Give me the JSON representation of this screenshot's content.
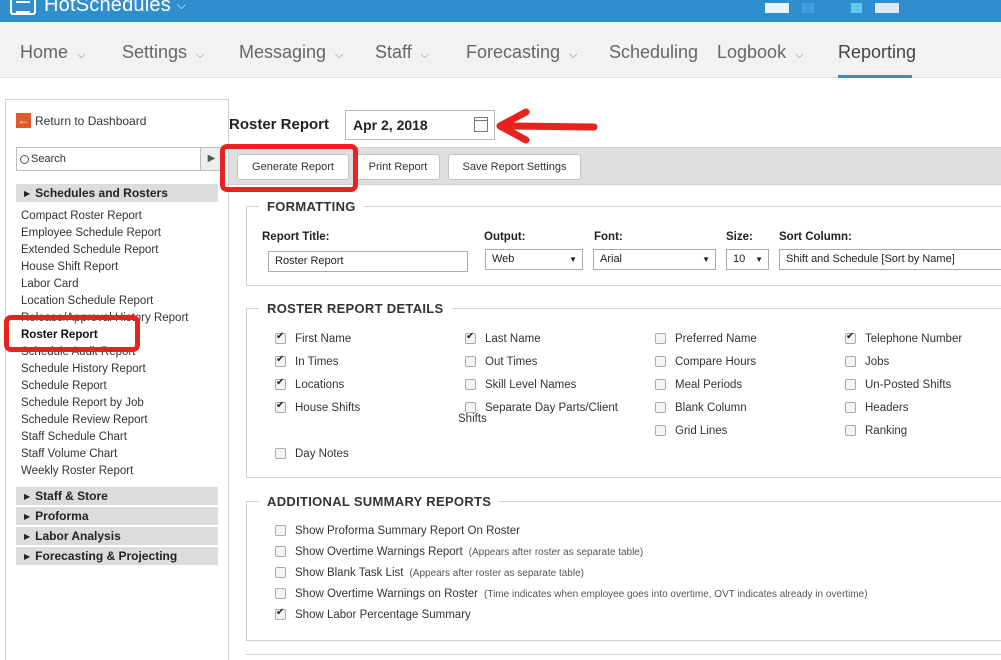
{
  "app": {
    "name": "HotSchedules"
  },
  "nav": [
    {
      "label": "Home",
      "caret": true
    },
    {
      "label": "Settings",
      "caret": true
    },
    {
      "label": "Messaging",
      "caret": true
    },
    {
      "label": "Staff",
      "caret": true
    },
    {
      "label": "Forecasting",
      "caret": true
    },
    {
      "label": "Scheduling",
      "caret": false
    },
    {
      "label": "Logbook",
      "caret": true
    },
    {
      "label": "Reporting",
      "caret": false,
      "active": true
    }
  ],
  "sidebar": {
    "return_label": "Return to Dashboard",
    "search_placeholder": "Search",
    "sections": [
      "Schedules and Rosters",
      "Staff & Store",
      "Proforma",
      "Labor Analysis",
      "Forecasting & Projecting"
    ],
    "links": [
      "Compact Roster Report",
      "Employee Schedule Report",
      "Extended Schedule Report",
      "House Shift Report",
      "Labor Card",
      "Location Schedule Report",
      "Release/Approval History Report",
      "Roster Report",
      "Schedule Audit Report",
      "Schedule History Report",
      "Schedule Report",
      "Schedule Report by Job",
      "Schedule Review Report",
      "Staff Schedule Chart",
      "Staff Volume Chart",
      "Weekly Roster Report"
    ],
    "selected_link": "Roster Report"
  },
  "main": {
    "title": "Roster Report",
    "date": "Apr 2, 2018",
    "buttons": {
      "generate": "Generate Report",
      "print": "Print Report",
      "save": "Save Report Settings"
    }
  },
  "formatting": {
    "legend": "FORMATTING",
    "report_title_label": "Report Title:",
    "report_title_value": "Roster Report",
    "output_label": "Output:",
    "output_value": "Web",
    "font_label": "Font:",
    "font_value": "Arial",
    "size_label": "Size:",
    "size_value": "10",
    "sort_label": "Sort Column:",
    "sort_value": "Shift and Schedule [Sort by Name]"
  },
  "details": {
    "legend": "ROSTER REPORT DETAILS",
    "items": [
      {
        "label": "First Name",
        "checked": true
      },
      {
        "label": "In Times",
        "checked": true
      },
      {
        "label": "Locations",
        "checked": true
      },
      {
        "label": "House Shifts",
        "checked": true
      },
      {
        "label": "Day Notes",
        "checked": false
      },
      {
        "label": "Last Name",
        "checked": true
      },
      {
        "label": "Out Times",
        "checked": false
      },
      {
        "label": "Skill Level Names",
        "checked": false
      },
      {
        "label": "Separate Day Parts/Client",
        "checked": false
      },
      {
        "label": "Preferred Name",
        "checked": false
      },
      {
        "label": "Compare Hours",
        "checked": false
      },
      {
        "label": "Meal Periods",
        "checked": false
      },
      {
        "label": "Blank Column",
        "checked": false
      },
      {
        "label": "Grid Lines",
        "checked": false
      },
      {
        "label": "Telephone Number",
        "checked": true
      },
      {
        "label": "Jobs",
        "checked": false
      },
      {
        "label": "Un-Posted Shifts",
        "checked": false
      },
      {
        "label": "Headers",
        "checked": false
      },
      {
        "label": "Ranking",
        "checked": false
      }
    ],
    "wrap_text": "Shifts"
  },
  "summary": {
    "legend": "ADDITIONAL SUMMARY REPORTS",
    "items": [
      {
        "label": "Show Proforma Summary Report On Roster",
        "note": "",
        "checked": false
      },
      {
        "label": "Show Overtime Warnings Report",
        "note": "(Appears after roster as separate table)",
        "checked": false
      },
      {
        "label": "Show Blank Task List",
        "note": "(Appears after roster as separate table)",
        "checked": false
      },
      {
        "label": "Show Overtime Warnings on Roster",
        "note": "(Time indicates when employee goes into overtime, OVT indicates already in overtime)",
        "checked": false
      },
      {
        "label": "Show Labor Percentage Summary",
        "note": "",
        "checked": true
      }
    ]
  },
  "colors": {
    "brand_blue": "#2f8fce",
    "annotation_red": "#e8231f"
  }
}
